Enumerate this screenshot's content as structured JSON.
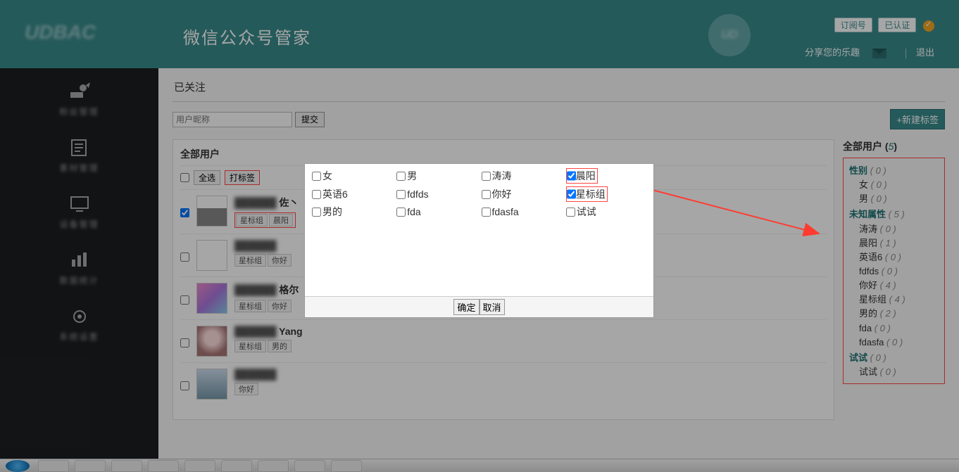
{
  "header": {
    "app_title": "微信公众号管家",
    "sub_badge": "订阅号",
    "auth_badge": "已认证",
    "share_text": "分享您的乐趣",
    "logout": "退出"
  },
  "sidebar": {
    "items": [
      {
        "icon": "users",
        "label": "粉丝管理"
      },
      {
        "icon": "file",
        "label": "素材管理"
      },
      {
        "icon": "monitor",
        "label": "设备管理"
      },
      {
        "icon": "chart",
        "label": "数据统计"
      },
      {
        "icon": "settings",
        "label": "系统设置"
      }
    ]
  },
  "main": {
    "tab": "已关注",
    "search_placeholder": "用户昵称",
    "submit": "提交",
    "new_tag": "+新建标签",
    "panel_title": "全部用户",
    "select_all": "全选",
    "tag_action": "打标签",
    "users": [
      {
        "name_prefix": "",
        "name_suffix": "佐丶",
        "tags": [
          "星标组",
          "晨阳"
        ],
        "checked": true
      },
      {
        "name_prefix": "",
        "name_suffix": "",
        "tags": [
          "星标组",
          "你好"
        ],
        "checked": false
      },
      {
        "name_prefix": "",
        "name_suffix": "格尔",
        "tags": [
          "星标组",
          "你好"
        ],
        "checked": false
      },
      {
        "name_prefix": "",
        "name_suffix": "Yang",
        "tags": [
          "星标组",
          "男的"
        ],
        "checked": false
      },
      {
        "name_prefix": "",
        "name_suffix": "",
        "tags": [
          "你好"
        ],
        "checked": false
      }
    ]
  },
  "side": {
    "title": "全部用户",
    "total": "5",
    "groups": [
      {
        "name": "性别",
        "count": "0",
        "items": [
          {
            "name": "女",
            "count": "0"
          },
          {
            "name": "男",
            "count": "0"
          }
        ]
      },
      {
        "name": "未知属性",
        "count": "5",
        "items": [
          {
            "name": "涛涛",
            "count": "0"
          },
          {
            "name": "晨阳",
            "count": "1"
          },
          {
            "name": "英语6",
            "count": "0"
          },
          {
            "name": "fdfds",
            "count": "0"
          },
          {
            "name": "你好",
            "count": "4"
          },
          {
            "name": "星标组",
            "count": "4"
          },
          {
            "name": "男的",
            "count": "2"
          },
          {
            "name": "fda",
            "count": "0"
          },
          {
            "name": "fdasfa",
            "count": "0"
          }
        ]
      },
      {
        "name": "试试",
        "count": "0",
        "items": [
          {
            "name": "试试",
            "count": "0"
          }
        ]
      }
    ]
  },
  "dialog": {
    "options": [
      {
        "label": "女",
        "checked": false
      },
      {
        "label": "男",
        "checked": false
      },
      {
        "label": "涛涛",
        "checked": false
      },
      {
        "label": "晨阳",
        "checked": true,
        "highlight": true
      },
      {
        "label": "英语6",
        "checked": false
      },
      {
        "label": "fdfds",
        "checked": false
      },
      {
        "label": "你好",
        "checked": false
      },
      {
        "label": "星标组",
        "checked": true,
        "highlight": true
      },
      {
        "label": "男的",
        "checked": false
      },
      {
        "label": "fda",
        "checked": false
      },
      {
        "label": "fdasfa",
        "checked": false
      },
      {
        "label": "试试",
        "checked": false
      }
    ],
    "ok": "确定",
    "cancel": "取消"
  }
}
